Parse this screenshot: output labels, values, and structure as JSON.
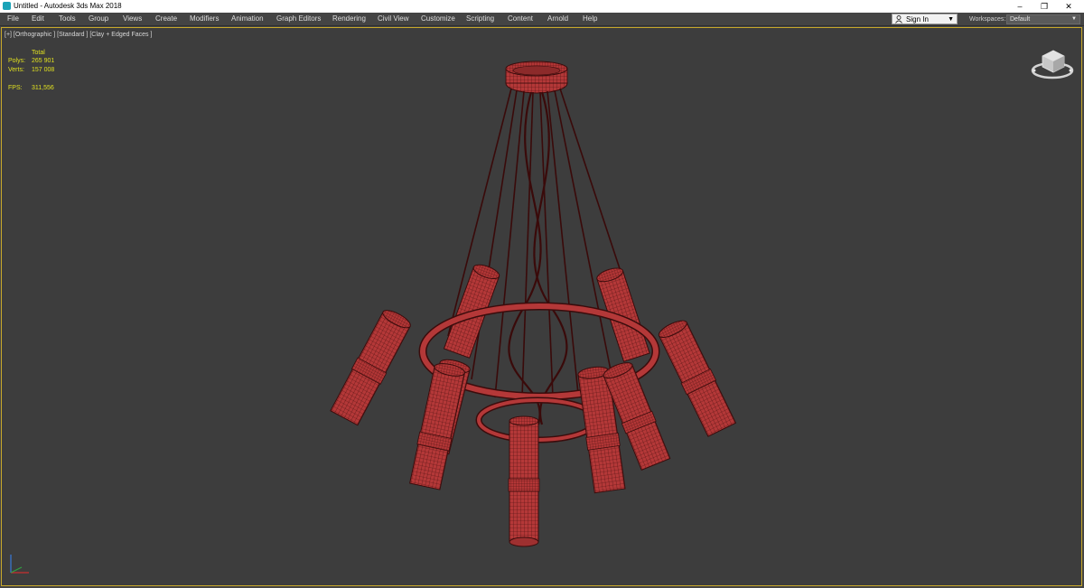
{
  "window": {
    "title": "Untitled - Autodesk 3ds Max 2018",
    "minimize_glyph": "–",
    "restore_glyph": "❐",
    "close_glyph": "✕"
  },
  "menu": [
    "File",
    "Edit",
    "Tools",
    "Group",
    "Views",
    "Create",
    "Modifiers",
    "Animation",
    "Graph Editors",
    "Rendering",
    "Civil View",
    "Customize",
    "Scripting",
    "Content",
    "Arnold",
    "Help"
  ],
  "signin": {
    "label": "Sign In",
    "icon": "user-icon"
  },
  "workspaces": {
    "label": "Workspaces:",
    "value": "Default"
  },
  "viewport": {
    "label": "[+] [Orthographic ] [Standard ] [Clay + Edged Faces ]",
    "stats": {
      "total_label": "Total",
      "polys_label": "Polys:",
      "polys_value": "265 901",
      "verts_label": "Verts:",
      "verts_value": "157 008",
      "fps_label": "FPS:",
      "fps_value": "311,556"
    }
  },
  "colors": {
    "accent_border": "#c8a82a",
    "stats_text": "#e0e020",
    "model_fill": "#b53a3a",
    "wire": "#3a0c0c",
    "viewport_bg": "#3d3d3d"
  }
}
